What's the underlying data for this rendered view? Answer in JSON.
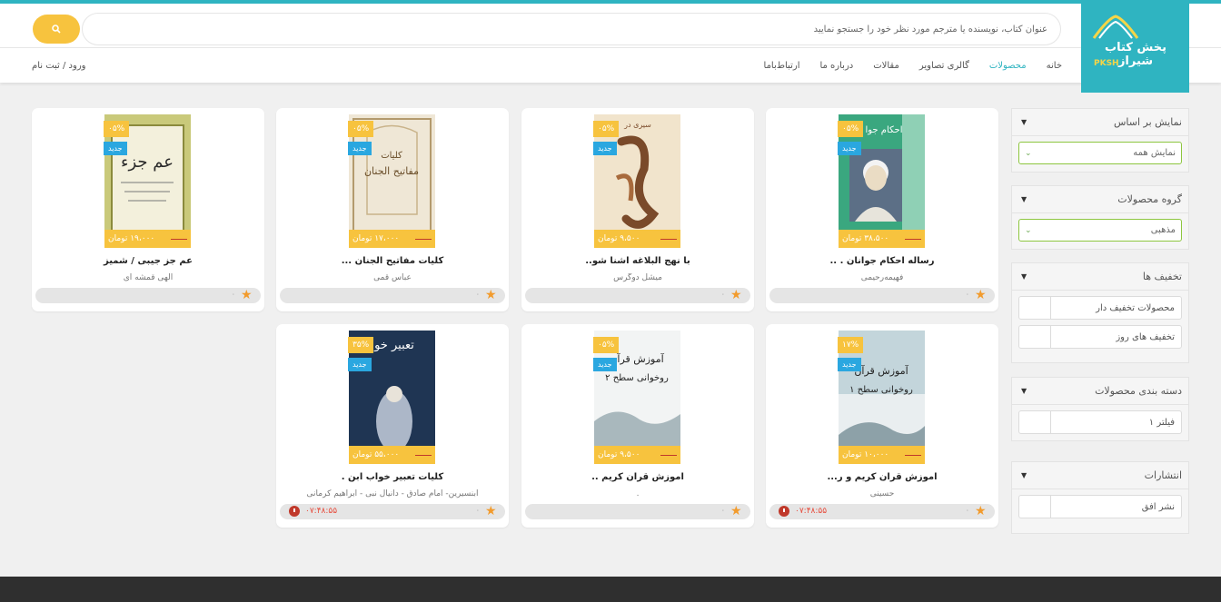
{
  "logo": {
    "text": "پخش کتاب شیراز",
    "sub": "PKSH"
  },
  "search": {
    "placeholder": "عنوان کتاب، نویسنده یا مترجم مورد نظر خود را جستجو نمایید"
  },
  "nav": {
    "items": [
      "خانه",
      "محصولات",
      "گالری تصاویر",
      "مقالات",
      "درباره ما",
      "ارتباط‌با‌ما"
    ],
    "active": "محصولات",
    "login": "ورود / ثبت نام"
  },
  "sidebar": {
    "sort": {
      "title": "نمایش بر اساس",
      "value": "نمایش همه"
    },
    "group": {
      "title": "گروه محصولات",
      "value": "مذهبی"
    },
    "discounts": {
      "title": "تخفیف ها",
      "options": [
        "محصولات تخفیف دار",
        "تخفیف های روز"
      ]
    },
    "category": {
      "title": "دسته بندی محصولات",
      "options": [
        "فیلتر ۱"
      ]
    },
    "publishers": {
      "title": "انتشارات",
      "options": [
        "نشر افق"
      ]
    }
  },
  "products": [
    {
      "title": "رساله احکام جوانان . ..",
      "author": "فهیمه‌رحیمی",
      "price": "۳۸،۵۰۰ تومان",
      "discount": "۰۵%",
      "badge": "جدید",
      "rating_count": "۰",
      "timer": ""
    },
    {
      "title": "با نهج البلاغه آشنا شو..",
      "author": "میشل دوگرس",
      "price": "۹،۵۰۰ تومان",
      "discount": "۰۵%",
      "badge": "جدید",
      "rating_count": "۰",
      "timer": ""
    },
    {
      "title": "کلیات مفاتیح الجنان ...",
      "author": "عباس قمی",
      "price": "۱۷،۰۰۰ تومان",
      "discount": "۰۵%",
      "badge": "جدید",
      "rating_count": "۰",
      "timer": ""
    },
    {
      "title": "عم جز جیبی / شمیز",
      "author": "الهی قمشه ای",
      "price": "۱۹،۰۰۰ تومان",
      "discount": "۰۵%",
      "badge": "جدید",
      "rating_count": "۰",
      "timer": ""
    },
    {
      "title": "آموزش قرآن کریم و ر...",
      "author": "حسینی",
      "price": "۱۰،۰۰۰ تومان",
      "discount": "۱۷%",
      "badge": "جدید",
      "rating_count": "۰",
      "timer": "۰۷:۴۸:۵۵"
    },
    {
      "title": "آموزش قرآن کریم ..",
      "author": ".",
      "price": "۹،۵۰۰ تومان",
      "discount": "۰۵%",
      "badge": "جدید",
      "rating_count": "۰",
      "timer": ""
    },
    {
      "title": "کلیات تعبیر خواب ابن .",
      "author": "ابنسیرین- امام صادق - دانیال نبی - ابراهیم کرمانی",
      "price": "۵۵،۰۰۰ تومان",
      "discount": "۳۵%",
      "badge": "جدید",
      "rating_count": "۰",
      "timer": "۰۷:۴۸:۵۵"
    }
  ]
}
